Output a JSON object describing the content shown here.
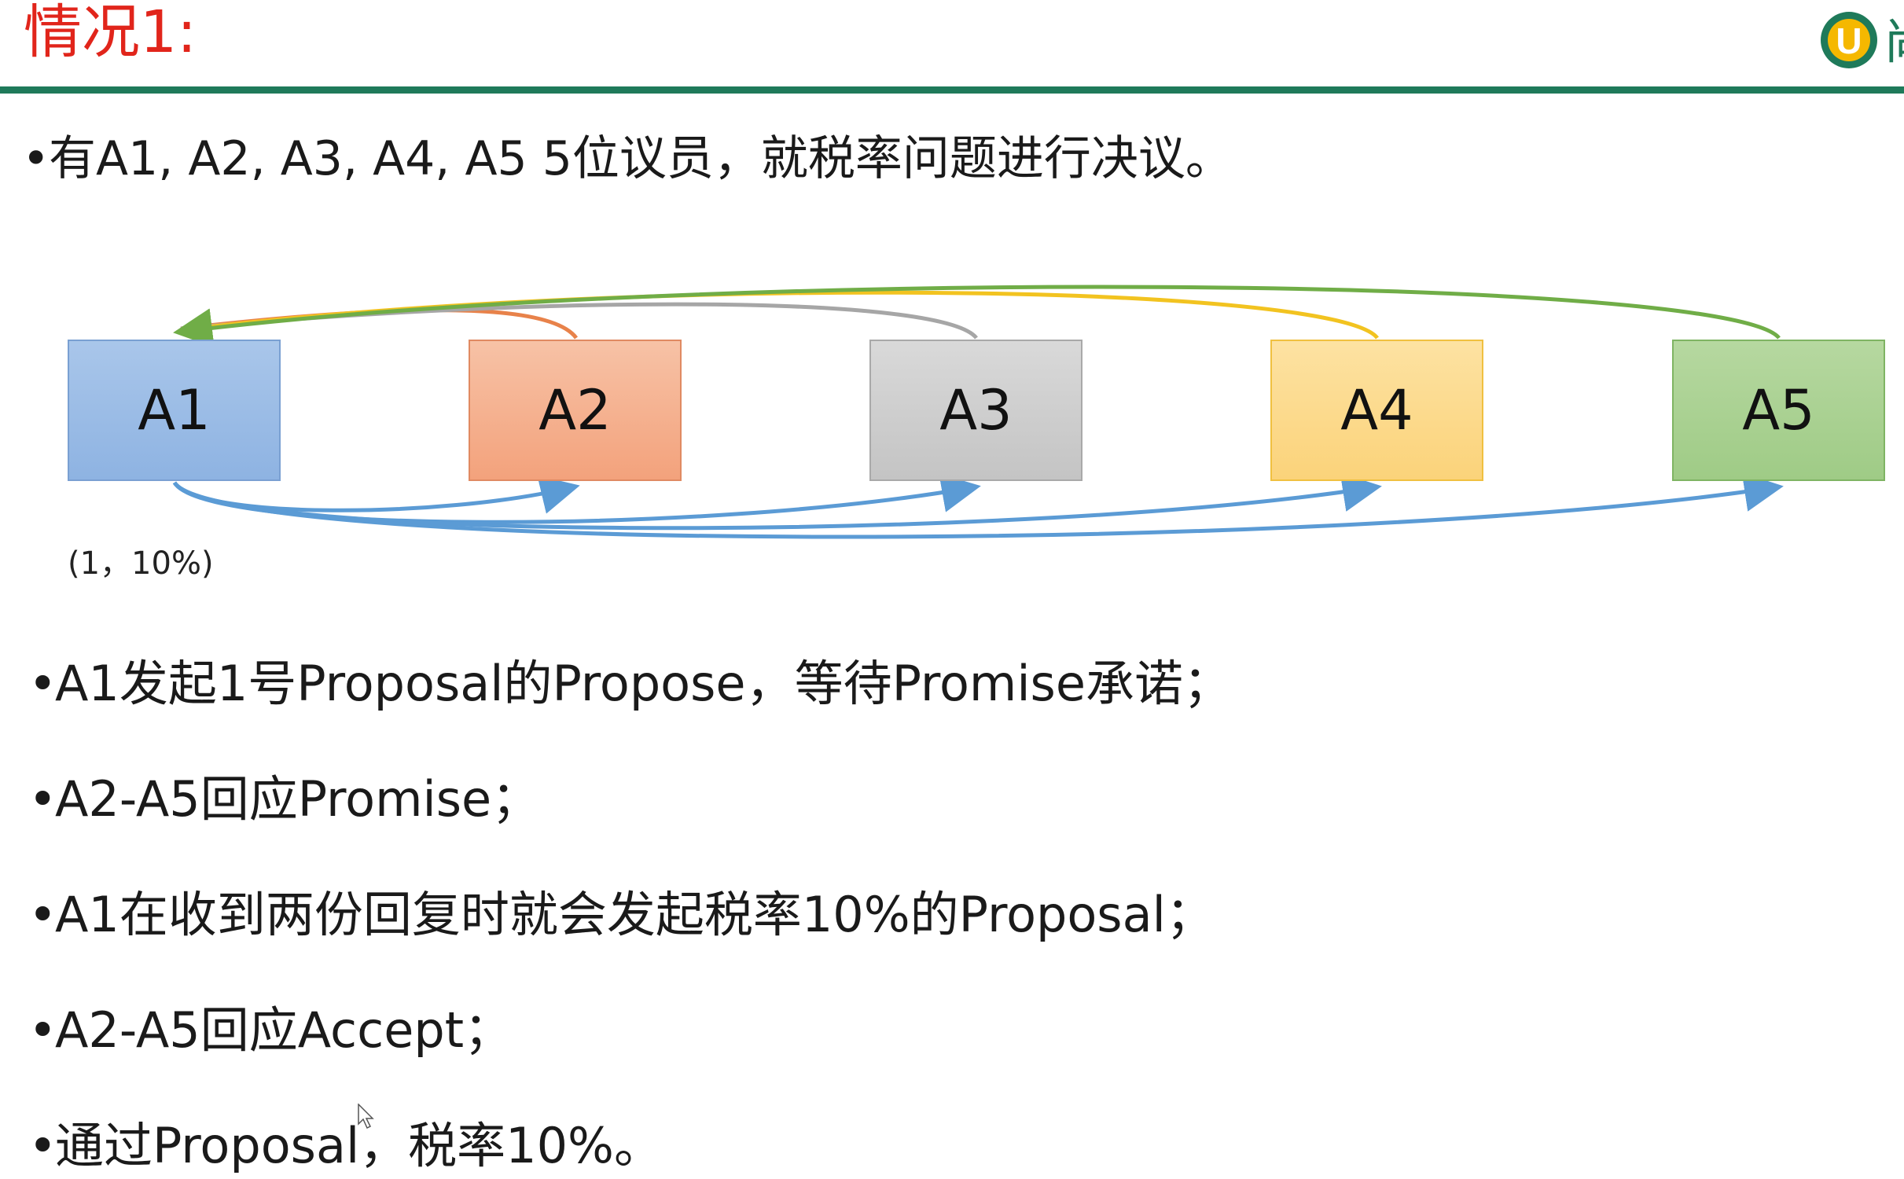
{
  "title": "情况1:",
  "intro": "有A1, A2, A3, A4, A5 5位议员，就税率问题进行决议。",
  "bullet_symbol": "•",
  "diagram": {
    "nodes": [
      "A1",
      "A2",
      "A3",
      "A4",
      "A5"
    ],
    "proposal_label": "(1，10%)",
    "colors": {
      "A2_reply": "#e8824a",
      "A3_reply": "#a6a6a6",
      "A4_reply": "#f2c320",
      "A5_reply": "#70ad47",
      "broadcast": "#5b9bd5"
    }
  },
  "bullets": [
    "A1发起1号Proposal的Propose，等待Promise承诺；",
    "A2-A5回应Promise；",
    "A1在收到两份回复时就会发起税率10%的Proposal；",
    "A2-A5回应Accept；",
    "通过Proposal，税率10%。"
  ],
  "logo": {
    "letter": "U",
    "partial_char": "尚",
    "ring_color": "#1f7a5a",
    "fill_color": "#f5b800"
  }
}
